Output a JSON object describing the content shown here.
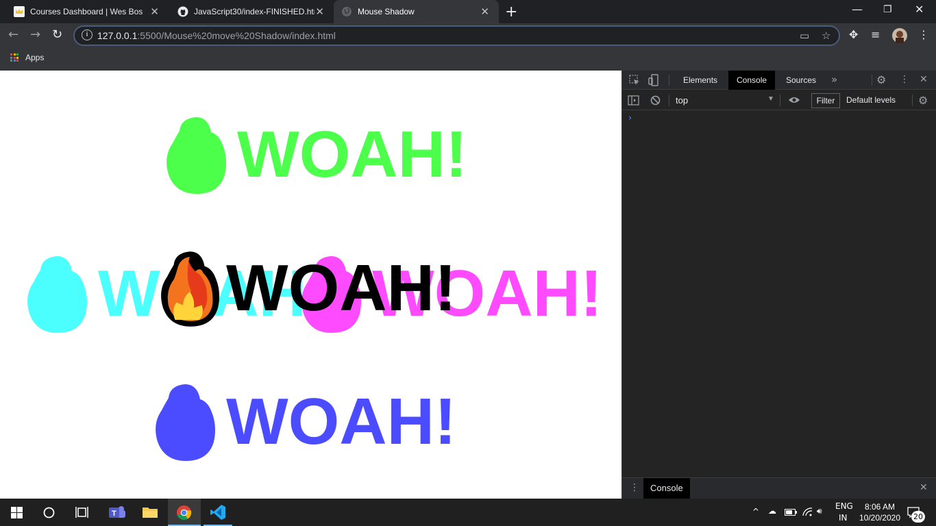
{
  "browser": {
    "tabs": [
      {
        "title": "Courses Dashboard | Wes Bos",
        "active": false
      },
      {
        "title": "JavaScript30/index-FINISHED.html",
        "active": false
      },
      {
        "title": "Mouse Shadow",
        "active": true
      }
    ],
    "new_tab_label": "+",
    "window_controls": {
      "minimize": "—",
      "restore": "❐",
      "close": "✕"
    },
    "tab_close_glyph": "✕",
    "url_host": "127.0.0.1",
    "url_rest": ":5500/Mouse%20move%20Shadow/index.html",
    "bookmarks": {
      "apps_label": "Apps"
    },
    "accent": "#8ab4f8"
  },
  "page": {
    "headings": [
      {
        "text": "WOAH!",
        "color": "#4bff4b",
        "role": "shadow-top"
      },
      {
        "text": "WOAH!",
        "color": "#4bffff",
        "role": "shadow-left"
      },
      {
        "text": "WOAH!",
        "color": "#ff4bff",
        "role": "shadow-right"
      },
      {
        "text": "WOAH!",
        "color": "#4b4bff",
        "role": "shadow-bottom"
      },
      {
        "text": "WOAH!",
        "color": "#000000",
        "role": "main"
      }
    ],
    "emoji_icon": "fire-icon"
  },
  "devtools": {
    "tabs": [
      "Elements",
      "Console",
      "Sources"
    ],
    "active_tab": "Console",
    "more_tabs_glyph": "»",
    "context": "top",
    "filter_placeholder": "Filter",
    "levels": "Default levels",
    "prompt_glyph": "›",
    "drawer_tab": "Console",
    "close_glyph": "✕"
  },
  "taskbar": {
    "language": "ENG",
    "region": "IN",
    "time": "8:06 AM",
    "date": "10/20/2020",
    "notification_count": "20"
  }
}
